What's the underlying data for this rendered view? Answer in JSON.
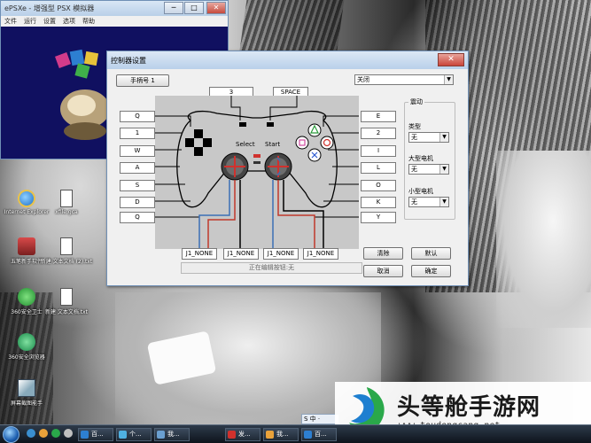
{
  "emulator_window": {
    "title": "ePSXe - 增强型 PSX 模拟器",
    "menu": [
      "文件",
      "运行",
      "设置",
      "选项",
      "帮助"
    ],
    "buttons": {
      "minimize": "─",
      "maximize": "□",
      "close": "✕"
    }
  },
  "dialog": {
    "title": "控制器设置",
    "close_label": "✕",
    "pad_selector": "手柄号 1",
    "mode_select": "关闭",
    "top_keys": {
      "l2": "3",
      "r2": "SPACE"
    },
    "center_labels": {
      "select": "Select",
      "start": "Start"
    },
    "left_keys": [
      "Q",
      "1",
      "W",
      "A",
      "S",
      "D",
      "Q"
    ],
    "right_keys": [
      "E",
      "2",
      "I",
      "L",
      "O",
      "K",
      "Y"
    ],
    "bottom_keys": [
      "J1_NONE",
      "J1_NONE",
      "J1_NONE",
      "J1_NONE"
    ],
    "status": "正在编辑按钮:无",
    "vibration": {
      "group_label": "震动",
      "type_label": "类型",
      "type_value": "无",
      "large_motor_label": "大型电机",
      "large_motor_value": "无",
      "small_motor_label": "小型电机",
      "small_motor_value": "无"
    },
    "buttons": {
      "clear": "清除",
      "default": "默认",
      "cancel": "取消",
      "ok": "确定"
    }
  },
  "desktop_icons": [
    {
      "label": "Internet Explorer"
    },
    {
      "label": "xfile.gca"
    },
    {
      "label": "五笔新手软件"
    },
    {
      "label": "新建 文本文档 (2).txt"
    },
    {
      "label": "360安全卫士"
    },
    {
      "label": "新建 文本文档.txt"
    },
    {
      "label": "360安全浏览器"
    },
    {
      "label": "屏幕截图能手"
    }
  ],
  "taskbar": {
    "buttons": [
      "百...",
      "个...",
      "我...",
      "发...",
      "我...",
      "百..."
    ],
    "ime": "S 中 ·"
  },
  "watermark": {
    "title": "头等舱手游网",
    "url": "www.toudengcang.net"
  },
  "colors": {
    "dialog_bg": "#f0f0f0",
    "title_bar": "#b9d0ea",
    "close_red": "#c9453a",
    "wire_red": "#c0392b",
    "wire_blue": "#3a6fb5"
  }
}
